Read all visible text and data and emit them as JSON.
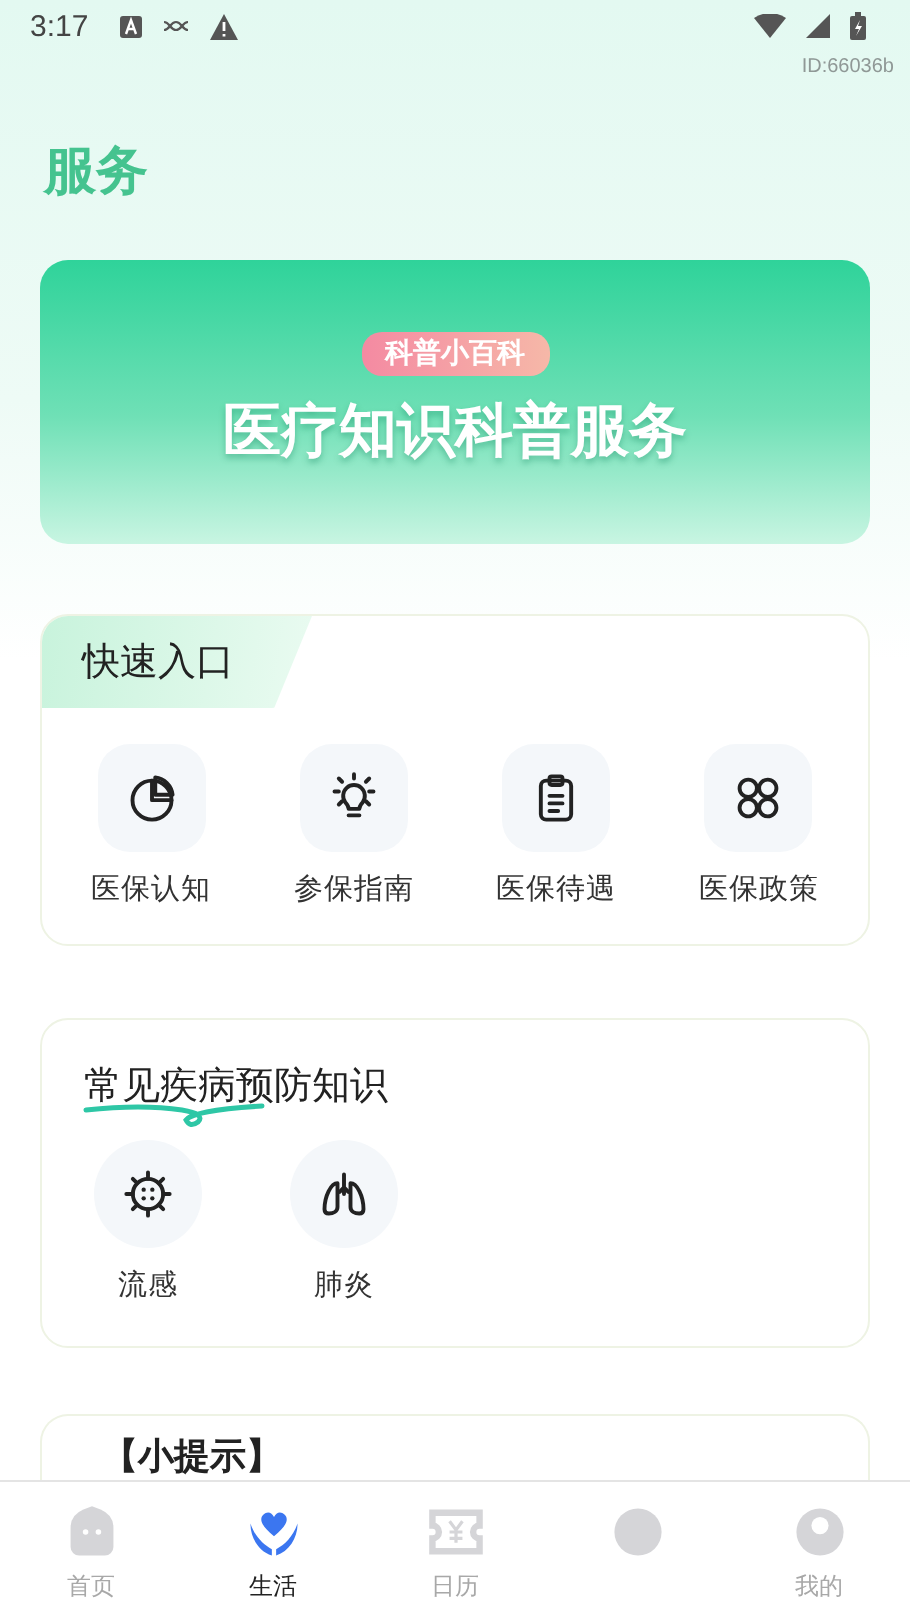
{
  "status_bar": {
    "time": "3:17"
  },
  "device_id": "ID:66036b",
  "page_title": "服务",
  "banner": {
    "badge": "科普小百科",
    "headline": "医疗知识科普服务"
  },
  "quick_entry": {
    "title": "快速入口",
    "items": [
      {
        "label": "医保认知"
      },
      {
        "label": "参保指南"
      },
      {
        "label": "医保待遇"
      },
      {
        "label": "医保政策"
      }
    ]
  },
  "diseases": {
    "title": "常见疾病预防知识",
    "items": [
      {
        "label": "流感"
      },
      {
        "label": "肺炎"
      }
    ]
  },
  "tips": {
    "title": "【小提示】"
  },
  "tab_bar": [
    {
      "label": "首页",
      "selected": false
    },
    {
      "label": "生活",
      "selected": true
    },
    {
      "label": "日历",
      "selected": false
    },
    {
      "selected": false
    },
    {
      "label": "我的",
      "selected": false
    }
  ]
}
